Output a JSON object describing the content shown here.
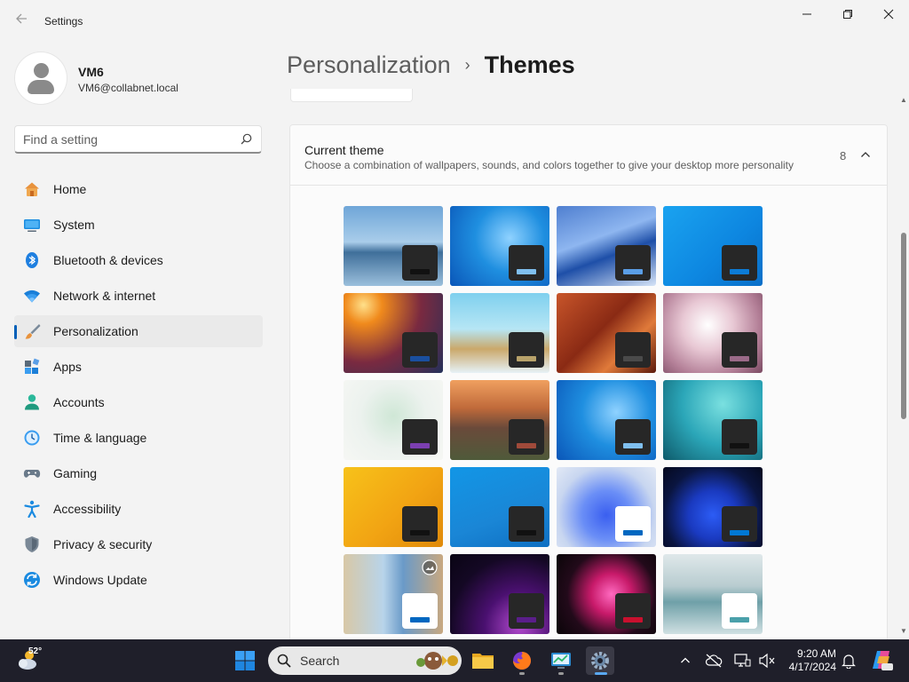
{
  "window": {
    "title": "Settings"
  },
  "user": {
    "name": "VM6",
    "email": "VM6@collabnet.local"
  },
  "search": {
    "placeholder": "Find a setting"
  },
  "nav": [
    {
      "label": "Home",
      "icon": "home-icon"
    },
    {
      "label": "System",
      "icon": "system-icon"
    },
    {
      "label": "Bluetooth & devices",
      "icon": "bluetooth-icon"
    },
    {
      "label": "Network & internet",
      "icon": "wifi-icon"
    },
    {
      "label": "Personalization",
      "icon": "brush-icon",
      "active": true
    },
    {
      "label": "Apps",
      "icon": "apps-icon"
    },
    {
      "label": "Accounts",
      "icon": "accounts-icon"
    },
    {
      "label": "Time & language",
      "icon": "clock-globe-icon"
    },
    {
      "label": "Gaming",
      "icon": "gamepad-icon"
    },
    {
      "label": "Accessibility",
      "icon": "accessibility-icon"
    },
    {
      "label": "Privacy & security",
      "icon": "shield-icon"
    },
    {
      "label": "Windows Update",
      "icon": "update-icon"
    }
  ],
  "header": {
    "parent": "Personalization",
    "separator": "›",
    "current": "Themes"
  },
  "current_theme": {
    "title": "Current theme",
    "subtitle": "Choose a combination of wallpapers, sounds, and colors together to give your desktop more personality",
    "count": "8"
  },
  "themes": [
    {
      "name": "beach-theme",
      "bg": "linear-gradient(180deg,#6fa6d8 0%,#a9cdea 45%,#3f6f9a 58%,#9bbfdc 100%)",
      "win": "#272727",
      "accent": "#111111"
    },
    {
      "name": "windows-7-blue-theme",
      "bg": "radial-gradient(circle at 60% 40%,#8fd2ff 0%,#1f8fe0 45%,#0a56b8 100%)",
      "win": "#272727",
      "accent": "#7fbfef"
    },
    {
      "name": "airplane-wing-theme",
      "bg": "linear-gradient(160deg,#4f7fd0 0%,#8eb6f0 40%,#1e4fa8 60%,#d6e4f7 100%)",
      "win": "#272727",
      "accent": "#5a9ee6"
    },
    {
      "name": "bright-blue-theme",
      "bg": "linear-gradient(135deg,#1aa3f0 0%,#0d86e0 60%,#0a6fc8 100%)",
      "win": "#272727",
      "accent": "#0c7bd6"
    },
    {
      "name": "sunset-tower-theme",
      "bg": "radial-gradient(circle at 20% 15%,#ffe08a 0%,#f08a1c 18%,#7a2a40 55%,#24305a 100%)",
      "win": "#272727",
      "accent": "#1a4f9f"
    },
    {
      "name": "flying-turtle-theme",
      "bg": "linear-gradient(180deg,#7fd0ee 0%,#b6e6f5 45%,#caa86a 70%,#e6f2f7 100%)",
      "win": "#272727",
      "accent": "#b8a26a"
    },
    {
      "name": "red-canyon-theme",
      "bg": "linear-gradient(135deg,#c8552a 0%,#8a2a14 45%,#e07a3a 70%,#5c1a0c 100%)",
      "win": "#272727",
      "accent": "#4a4a4a"
    },
    {
      "name": "dandelion-theme",
      "bg": "radial-gradient(circle at 45% 40%,#ffffff 0%,#e8c8d4 35%,#b48098 70%,#7a4a62 100%)",
      "win": "#272727",
      "accent": "#9a6a88"
    },
    {
      "name": "watercolor-tree-theme",
      "bg": "radial-gradient(circle at 50% 45%,#cfe7d6 0%,#ecf2ee 50%,#f6f7f4 100%)",
      "win": "#272727",
      "accent": "#7b3fb0"
    },
    {
      "name": "mountain-dusk-theme",
      "bg": "linear-gradient(180deg,#f0a060 0%,#c06a3a 35%,#6a4a3a 60%,#4f5a3a 100%)",
      "win": "#272727",
      "accent": "#a04a3a"
    },
    {
      "name": "windows-7-blue-theme-2",
      "bg": "radial-gradient(circle at 60% 40%,#8fd2ff 0%,#1f8fe0 45%,#0a56b8 100%)",
      "win": "#272727",
      "accent": "#7fbfef"
    },
    {
      "name": "red-bird-teal-theme",
      "bg": "radial-gradient(circle at 60% 30%,#7ae0e0 0%,#2ba6b8 50%,#0e5a6a 100%)",
      "win": "#272727",
      "accent": "#111111"
    },
    {
      "name": "yellow-fold-theme",
      "bg": "linear-gradient(135deg,#f7c21a 0%,#f2a413 55%,#e08a0a 100%)",
      "win": "#272727",
      "accent": "#111111"
    },
    {
      "name": "blue-cables-theme",
      "bg": "linear-gradient(160deg,#1296e6 0%,#1a86d6 60%,#0e6fc2 100%)",
      "win": "#272727",
      "accent": "#111111"
    },
    {
      "name": "windows-11-light-theme",
      "bg": "radial-gradient(circle at 50% 60%,#3a5ff0 0%,#6a8ef6 35%,#c8d6f0 70%,#e2e9f5 100%)",
      "win": "#ffffff",
      "accent": "#0067c0"
    },
    {
      "name": "windows-11-dark-theme",
      "bg": "radial-gradient(circle at 50% 60%,#2c5cf5 0%,#1a3ac0 35%,#0a1540 70%,#05091e 100%)",
      "win": "#272727",
      "accent": "#0078d4"
    },
    {
      "name": "spotlight-theme",
      "bg": "linear-gradient(90deg,#d8c8a6 0%,#b8d4ea 40%,#6a9ac8 60%,#c8a880 100%)",
      "win": "#ffffff",
      "accent": "#0067c0",
      "badge": true
    },
    {
      "name": "glow-purple-theme",
      "bg": "radial-gradient(circle at 70% 90%,#b44ad0 0%,#4a1070 35%,#140824 70%,#0a0514 100%)",
      "win": "#272727",
      "accent": "#5a1e8a"
    },
    {
      "name": "captured-motion-theme",
      "bg": "radial-gradient(circle at 55% 50%,#ff6ac0 0%,#c81a6a 30%,#220a1a 65%,#0a0508 100%)",
      "win": "#272727",
      "accent": "#c8102e"
    },
    {
      "name": "flow-lake-theme",
      "bg": "linear-gradient(180deg,#dfe8ea 0%,#b8ccd0 40%,#6fa0a8 60%,#d0e0e2 100%)",
      "win": "#ffffff",
      "accent": "#4aa0aa"
    }
  ],
  "taskbar": {
    "weather_temp": "52°",
    "search_label": "Search",
    "time": "9:20 AM",
    "date": "4/17/2024"
  },
  "colors": {
    "accent": "#005fb8",
    "taskbar": "#1f1f2a"
  }
}
